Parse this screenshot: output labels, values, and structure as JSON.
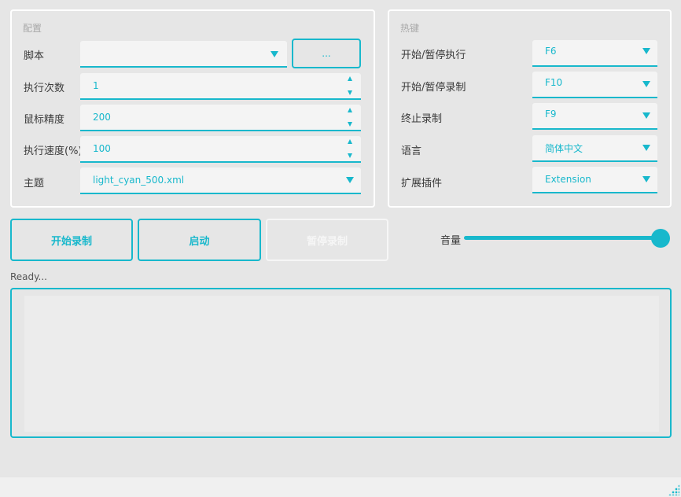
{
  "config": {
    "title": "配置",
    "script": {
      "label": "脚本",
      "value": "",
      "browse_label": "..."
    },
    "run_count": {
      "label": "执行次数",
      "value": "1"
    },
    "mouse_precision": {
      "label": "鼠标精度",
      "value": "200"
    },
    "run_speed": {
      "label": "执行速度(%)",
      "value": "100"
    },
    "theme": {
      "label": "主题",
      "value": "light_cyan_500.xml"
    }
  },
  "hotkeys": {
    "title": "热键",
    "start_pause_run": {
      "label": "开始/暂停执行",
      "value": "F6"
    },
    "start_pause_record": {
      "label": "开始/暂停录制",
      "value": "F10"
    },
    "stop_record": {
      "label": "终止录制",
      "value": "F9"
    },
    "language": {
      "label": "语言",
      "value": "简体中文"
    },
    "plugin": {
      "label": "扩展插件",
      "value": "Extension"
    }
  },
  "actions": {
    "start_record": "开始录制",
    "launch": "启动",
    "pause_record": "暂停录制"
  },
  "volume": {
    "label": "音量",
    "level_percent": 100
  },
  "status_text": "Ready...",
  "log": {
    "content": ""
  },
  "colors": {
    "accent": "#18b8cc",
    "background": "#e6e6e6",
    "field": "#f4f4f4"
  }
}
